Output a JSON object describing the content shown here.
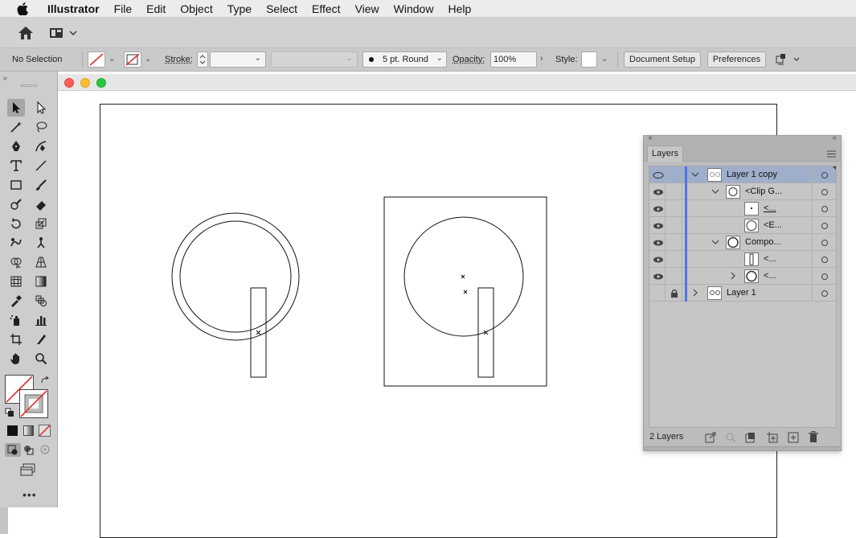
{
  "menubar": {
    "app": "Illustrator",
    "items": [
      "File",
      "Edit",
      "Object",
      "Type",
      "Select",
      "Effect",
      "View",
      "Window",
      "Help"
    ]
  },
  "control": {
    "selection": "No Selection",
    "stroke_label": "Stroke:",
    "brush": "5 pt. Round",
    "opacity_label": "Opacity:",
    "opacity_value": "100%",
    "style_label": "Style:",
    "document_setup": "Document Setup",
    "preferences": "Preferences"
  },
  "layers_panel": {
    "title": "Layers",
    "rows": [
      {
        "name": "Layer 1 copy"
      },
      {
        "name": "<Clip G..."
      },
      {
        "name": "<..."
      },
      {
        "name": "<E..."
      },
      {
        "name": "Compo..."
      },
      {
        "name": "<..."
      },
      {
        "name": "<..."
      },
      {
        "name": "Layer 1"
      }
    ],
    "count": "2 Layers"
  },
  "colors": {
    "accent_layer": "#4f77e3",
    "highlight_row": "#9eaecb",
    "close": "#fc5f57",
    "minimize": "#fdbc2e",
    "zoom": "#28c840"
  }
}
